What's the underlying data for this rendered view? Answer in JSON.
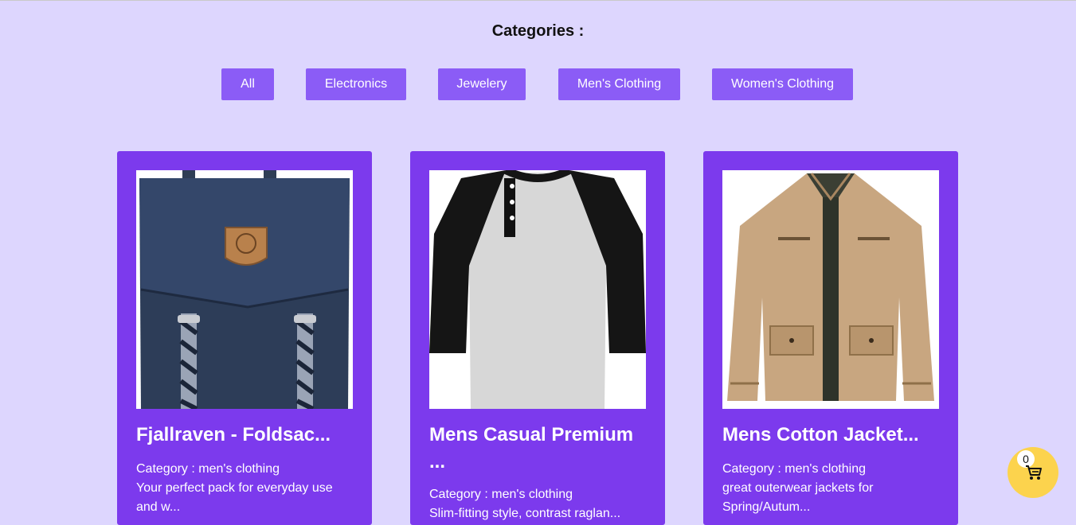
{
  "categories": {
    "heading": "Categories :",
    "buttons": [
      "All",
      "Electronics",
      "Jewelery",
      "Men's Clothing",
      "Women's Clothing"
    ]
  },
  "products": [
    {
      "title": "Fjallraven - Foldsac...",
      "category": "Category : men's clothing",
      "description": "Your perfect pack for everyday use and w...",
      "image_icon": "backpack-image"
    },
    {
      "title": "Mens Casual Premium ...",
      "category": "Category : men's clothing",
      "description": "Slim-fitting style, contrast raglan...",
      "image_icon": "raglan-shirt-image"
    },
    {
      "title": "Mens Cotton Jacket...",
      "category": "Category : men's clothing",
      "description": "great outerwear jackets for Spring/Autum...",
      "image_icon": "jacket-image"
    }
  ],
  "cart": {
    "count": "0",
    "icon": "cart-icon",
    "color": "#fcd34d"
  },
  "colors": {
    "background": "#ddd6fe",
    "button": "#8b5cf6",
    "card": "#7c3aed"
  }
}
